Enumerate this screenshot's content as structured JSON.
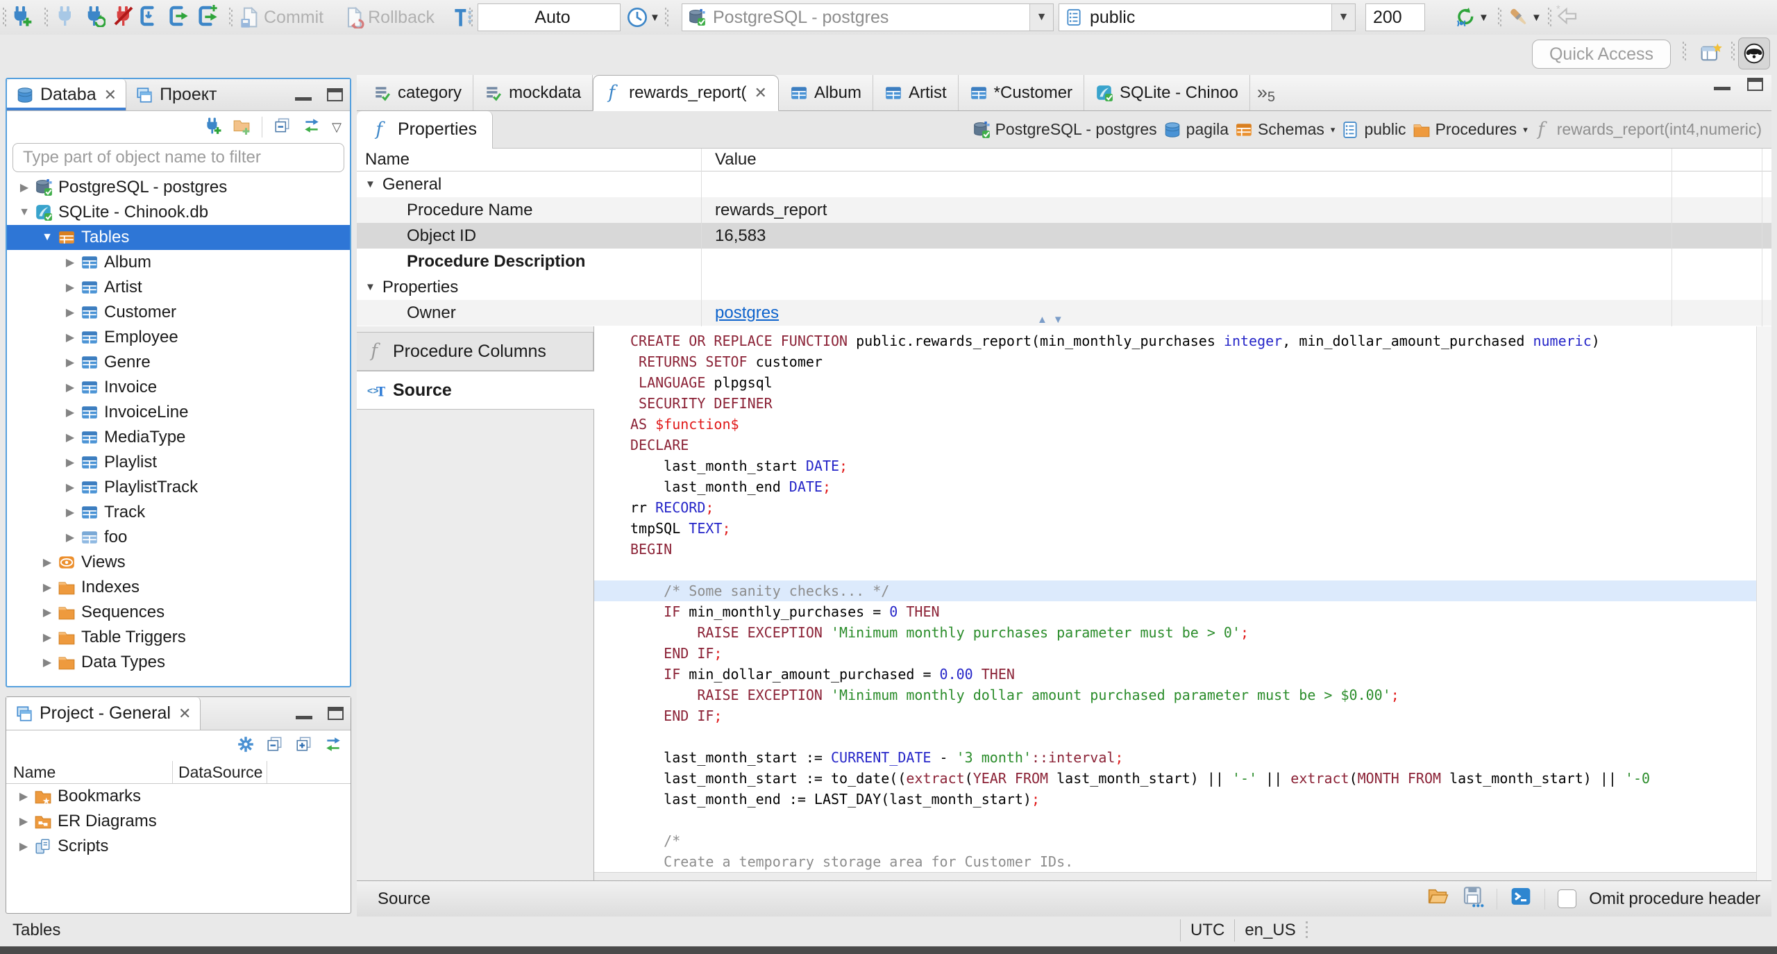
{
  "colors": {
    "selection_blue": "#2e76d6",
    "focus_border_blue": "#55a0de",
    "accent_blue": "#3c86c8",
    "folder_orange": "#ee9a3e",
    "keyword_maroon": "#8b2236",
    "type_number_blue": "#2525c8",
    "string_green": "#2a8c2a",
    "punctuation_red": "#e01818",
    "comment_gray": "#8c8c8c",
    "link_blue": "#0b62cc"
  },
  "toolbar": {
    "commit": "Commit",
    "rollback": "Rollback",
    "auto_commit": "Auto",
    "connection": "PostgreSQL - postgres",
    "schema": "public",
    "fetch_size": "200",
    "quick_access_placeholder": "Quick Access"
  },
  "navigator": {
    "database_tab": "Databa",
    "project_tab": "Проект",
    "filter_placeholder": "Type part of object name to filter",
    "tree": [
      {
        "label": "PostgreSQL - postgres",
        "level": 0,
        "state": "collapsed",
        "icon": "postgres-db"
      },
      {
        "label": "SQLite - Chinook.db",
        "level": 0,
        "state": "expanded",
        "icon": "sqlite-db"
      },
      {
        "label": "Tables",
        "level": 1,
        "state": "expanded",
        "icon": "tables-folder",
        "selected": true
      },
      {
        "label": "Album",
        "level": 2,
        "state": "collapsed",
        "icon": "table"
      },
      {
        "label": "Artist",
        "level": 2,
        "state": "collapsed",
        "icon": "table"
      },
      {
        "label": "Customer",
        "level": 2,
        "state": "collapsed",
        "icon": "table"
      },
      {
        "label": "Employee",
        "level": 2,
        "state": "collapsed",
        "icon": "table"
      },
      {
        "label": "Genre",
        "level": 2,
        "state": "collapsed",
        "icon": "table"
      },
      {
        "label": "Invoice",
        "level": 2,
        "state": "collapsed",
        "icon": "table"
      },
      {
        "label": "InvoiceLine",
        "level": 2,
        "state": "collapsed",
        "icon": "table"
      },
      {
        "label": "MediaType",
        "level": 2,
        "state": "collapsed",
        "icon": "table"
      },
      {
        "label": "Playlist",
        "level": 2,
        "state": "collapsed",
        "icon": "table"
      },
      {
        "label": "PlaylistTrack",
        "level": 2,
        "state": "collapsed",
        "icon": "table"
      },
      {
        "label": "Track",
        "level": 2,
        "state": "collapsed",
        "icon": "table"
      },
      {
        "label": "foo",
        "level": 2,
        "state": "collapsed",
        "icon": "table-light"
      },
      {
        "label": "Views",
        "level": 1,
        "state": "collapsed",
        "icon": "views"
      },
      {
        "label": "Indexes",
        "level": 1,
        "state": "collapsed",
        "icon": "folder"
      },
      {
        "label": "Sequences",
        "level": 1,
        "state": "collapsed",
        "icon": "folder"
      },
      {
        "label": "Table Triggers",
        "level": 1,
        "state": "collapsed",
        "icon": "folder"
      },
      {
        "label": "Data Types",
        "level": 1,
        "state": "collapsed",
        "icon": "folder"
      }
    ]
  },
  "project": {
    "title": "Project - General",
    "columns": [
      "Name",
      "DataSource"
    ],
    "items": [
      {
        "label": "Bookmarks",
        "icon": "folder-bookmarks"
      },
      {
        "label": "ER Diagrams",
        "icon": "folder-er"
      },
      {
        "label": "Scripts",
        "icon": "scripts"
      }
    ]
  },
  "editor": {
    "tabs": [
      {
        "label": "category",
        "icon": "sql-file"
      },
      {
        "label": "mockdata",
        "icon": "sql-file"
      },
      {
        "label": "rewards_report(",
        "icon": "function",
        "active": true,
        "closable": true
      },
      {
        "label": "Album",
        "icon": "table"
      },
      {
        "label": "Artist",
        "icon": "table"
      },
      {
        "label": "*Customer",
        "icon": "table"
      },
      {
        "label": "SQLite - Chinoo",
        "icon": "sqlite-db"
      }
    ],
    "overflow_count": "5",
    "properties_tab": "Properties",
    "breadcrumb": [
      {
        "label": "PostgreSQL - postgres",
        "icon": "postgres-db"
      },
      {
        "label": "pagila",
        "icon": "database"
      },
      {
        "label": "Schemas",
        "icon": "tables-folder",
        "dropdown": true
      },
      {
        "label": "public",
        "icon": "schema"
      },
      {
        "label": "Procedures",
        "icon": "folder",
        "dropdown": true
      },
      {
        "label": "rewards_report(int4,numeric)",
        "icon": "function-gray",
        "muted": true
      }
    ],
    "grid": {
      "columns": [
        "Name",
        "Value"
      ],
      "rows": [
        {
          "type": "group",
          "name": "General"
        },
        {
          "type": "item",
          "name": "Procedure Name",
          "value": "rewards_report",
          "shade": true
        },
        {
          "type": "item",
          "name": "Object ID",
          "value": "16,583",
          "selected": true
        },
        {
          "type": "item",
          "name": "Procedure Description",
          "value": "",
          "bold": true
        },
        {
          "type": "group",
          "name": "Properties"
        },
        {
          "type": "item",
          "name": "Owner",
          "value": "postgres",
          "link": true,
          "shade": true
        }
      ]
    },
    "side_tabs": [
      {
        "label": "Procedure Columns",
        "icon": "function-gray"
      },
      {
        "label": "Source",
        "icon": "source-tag",
        "active": true
      }
    ],
    "status_label": "Source",
    "omit_checkbox_label": "Omit procedure header"
  },
  "source_code": {
    "highlighted_line": 12,
    "lines": [
      [
        [
          "k",
          "CREATE OR REPLACE FUNCTION"
        ],
        [
          "x",
          " public.rewards_report(min_monthly_purchases "
        ],
        [
          "t",
          "integer"
        ],
        [
          "x",
          ", min_dollar_amount_purchased "
        ],
        [
          "t",
          "numeric"
        ],
        [
          "x",
          ")"
        ]
      ],
      [
        [
          "x",
          " "
        ],
        [
          "k",
          "RETURNS SETOF"
        ],
        [
          "x",
          " customer"
        ]
      ],
      [
        [
          "x",
          " "
        ],
        [
          "k",
          "LANGUAGE"
        ],
        [
          "x",
          " plpgsql"
        ]
      ],
      [
        [
          "x",
          " "
        ],
        [
          "k",
          "SECURITY DEFINER"
        ]
      ],
      [
        [
          "k",
          "AS"
        ],
        [
          "x",
          " "
        ],
        [
          "r",
          "$function$"
        ]
      ],
      [
        [
          "k",
          "DECLARE"
        ]
      ],
      [
        [
          "x",
          "    last_month_start "
        ],
        [
          "t",
          "DATE"
        ],
        [
          "r",
          ";"
        ]
      ],
      [
        [
          "x",
          "    last_month_end "
        ],
        [
          "t",
          "DATE"
        ],
        [
          "r",
          ";"
        ]
      ],
      [
        [
          "x",
          "rr "
        ],
        [
          "t",
          "RECORD"
        ],
        [
          "r",
          ";"
        ]
      ],
      [
        [
          "x",
          "tmpSQL "
        ],
        [
          "t",
          "TEXT"
        ],
        [
          "r",
          ";"
        ]
      ],
      [
        [
          "k",
          "BEGIN"
        ]
      ],
      [],
      [
        [
          "c",
          "    /* Some sanity checks... */"
        ]
      ],
      [
        [
          "x",
          "    "
        ],
        [
          "k",
          "IF"
        ],
        [
          "x",
          " min_monthly_purchases = "
        ],
        [
          "t",
          "0"
        ],
        [
          "x",
          " "
        ],
        [
          "k",
          "THEN"
        ]
      ],
      [
        [
          "x",
          "        "
        ],
        [
          "k",
          "RAISE EXCEPTION"
        ],
        [
          "x",
          " "
        ],
        [
          "s",
          "'Minimum monthly purchases parameter must be > 0'"
        ],
        [
          "r",
          ";"
        ]
      ],
      [
        [
          "x",
          "    "
        ],
        [
          "k",
          "END IF"
        ],
        [
          "r",
          ";"
        ]
      ],
      [
        [
          "x",
          "    "
        ],
        [
          "k",
          "IF"
        ],
        [
          "x",
          " min_dollar_amount_purchased = "
        ],
        [
          "t",
          "0.00"
        ],
        [
          "x",
          " "
        ],
        [
          "k",
          "THEN"
        ]
      ],
      [
        [
          "x",
          "        "
        ],
        [
          "k",
          "RAISE EXCEPTION"
        ],
        [
          "x",
          " "
        ],
        [
          "s",
          "'Minimum monthly dollar amount purchased parameter must be > $0.00'"
        ],
        [
          "r",
          ";"
        ]
      ],
      [
        [
          "x",
          "    "
        ],
        [
          "k",
          "END IF"
        ],
        [
          "r",
          ";"
        ]
      ],
      [],
      [
        [
          "x",
          "    last_month_start := "
        ],
        [
          "t",
          "CURRENT_DATE"
        ],
        [
          "x",
          " - "
        ],
        [
          "s",
          "'3 month'"
        ],
        [
          "k",
          "::interval"
        ],
        [
          "r",
          ";"
        ]
      ],
      [
        [
          "x",
          "    last_month_start := to_date(("
        ],
        [
          "k",
          "extract"
        ],
        [
          "x",
          "("
        ],
        [
          "k",
          "YEAR FROM"
        ],
        [
          "x",
          " last_month_start) || "
        ],
        [
          "s",
          "'-'"
        ],
        [
          "x",
          " || "
        ],
        [
          "k",
          "extract"
        ],
        [
          "x",
          "("
        ],
        [
          "k",
          "MONTH FROM"
        ],
        [
          "x",
          " last_month_start) || "
        ],
        [
          "s",
          "'-0"
        ]
      ],
      [
        [
          "x",
          "    last_month_end := LAST_DAY(last_month_start)"
        ],
        [
          "r",
          ";"
        ]
      ],
      [],
      [
        [
          "c",
          "    /*"
        ]
      ],
      [
        [
          "c",
          "    Create a temporary storage area for Customer IDs."
        ]
      ],
      [
        [
          "c",
          "    */"
        ]
      ]
    ]
  },
  "statusbar": {
    "context": "Tables",
    "timezone": "UTC",
    "locale": "en_US"
  }
}
